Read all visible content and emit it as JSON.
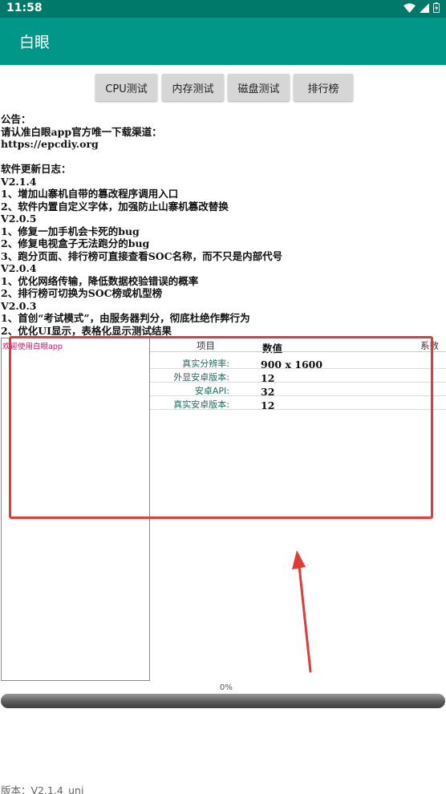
{
  "status_bar": {
    "time": "11:58",
    "icons": [
      "wifi-icon",
      "signal-icon",
      "battery-charging-icon"
    ]
  },
  "app_bar": {
    "title": "白眼",
    "color": "#009688"
  },
  "top_buttons": {
    "cpu": "CPU测试",
    "memory": "内存测试",
    "disk": "磁盘测试",
    "ranking": "排行榜"
  },
  "notice": {
    "lines": [
      "公告：",
      "请认准白眼app官方唯一下载渠道：",
      "https://epcdiy.org",
      "",
      "软件更新日志：",
      "V2.1.4",
      "1、增加山寨机自带的篡改程序调用入口",
      "2、软件内置自定义字体，加强防止山寨机篡改替换",
      "V2.0.5",
      "1、修复一加手机会卡死的bug",
      "2、修复电视盒子无法跑分的bug",
      "3、跑分页面、排行榜可直接查看SOC名称，而不只是内部代号",
      "V2.0.4",
      "1、优化网络传输，降低数据校验错误的概率",
      "2、排行榜可切换为SOC榜或机型榜",
      "V2.0.3",
      "1、首创“考试模式”，由服务器判分，彻底杜绝作弊行为",
      "2、优化UI显示，表格化显示测试结果"
    ]
  },
  "left_panel": {
    "welcome": "欢迎使用白眼app"
  },
  "table": {
    "headers": {
      "item": "项目",
      "value": "数值",
      "coef": "系数"
    },
    "rows": [
      {
        "label": "真实分辨率:",
        "value": "900 x 1600"
      },
      {
        "label": "外显安卓版本:",
        "value": "12"
      },
      {
        "label": "安卓API:",
        "value": "32"
      },
      {
        "label": "真实安卓版本:",
        "value": "12"
      }
    ]
  },
  "progress": {
    "text": "0%",
    "value": 0
  },
  "footer": {
    "version": "版本：V2.1.4_uni"
  },
  "colors": {
    "status_bar": "#00796b",
    "app_bar": "#009688",
    "annotation": "#e53935"
  }
}
